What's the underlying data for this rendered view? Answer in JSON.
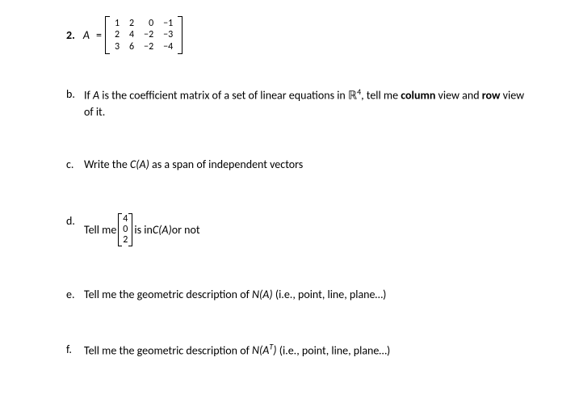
{
  "problem2": {
    "label": "2.",
    "var_letter": "A",
    "equals": "=",
    "matrix": {
      "rows": [
        [
          "1",
          "2",
          "0",
          "−1"
        ],
        [
          "2",
          "4",
          "−2",
          "−3"
        ],
        [
          "3",
          "6",
          "−2",
          "−4"
        ]
      ]
    }
  },
  "item_b": {
    "label": "b.",
    "before_bold1": "If ",
    "italic_A": "A",
    "mid1": " is the coefficient matrix of a set of linear equations in ",
    "r4": "ℝ",
    "sup4": "4",
    "mid2": ", tell me ",
    "bold_column": "column",
    "mid3": " view and ",
    "bold_row": "row",
    "end": " view of it."
  },
  "item_c": {
    "label": "c.",
    "before": "Write the ",
    "ca": "C(A)",
    "after": " as a span of independent vectors"
  },
  "item_d": {
    "label": "d.",
    "before": "Tell me ",
    "vector": [
      "4",
      "0",
      "2"
    ],
    "mid": " is in ",
    "ca": "C(A)",
    "after": " or not"
  },
  "item_e": {
    "label": "e.",
    "before": "Tell me the geometric description of ",
    "na": "N(A)",
    "after": " (i.e., point, line, plane…)"
  },
  "item_f": {
    "label": "f.",
    "before": "Tell me the geometric description of ",
    "nat_n": "N(A",
    "sup_t": "T",
    "nat_close": ")",
    "after": " (i.e., point, line, plane…)"
  }
}
